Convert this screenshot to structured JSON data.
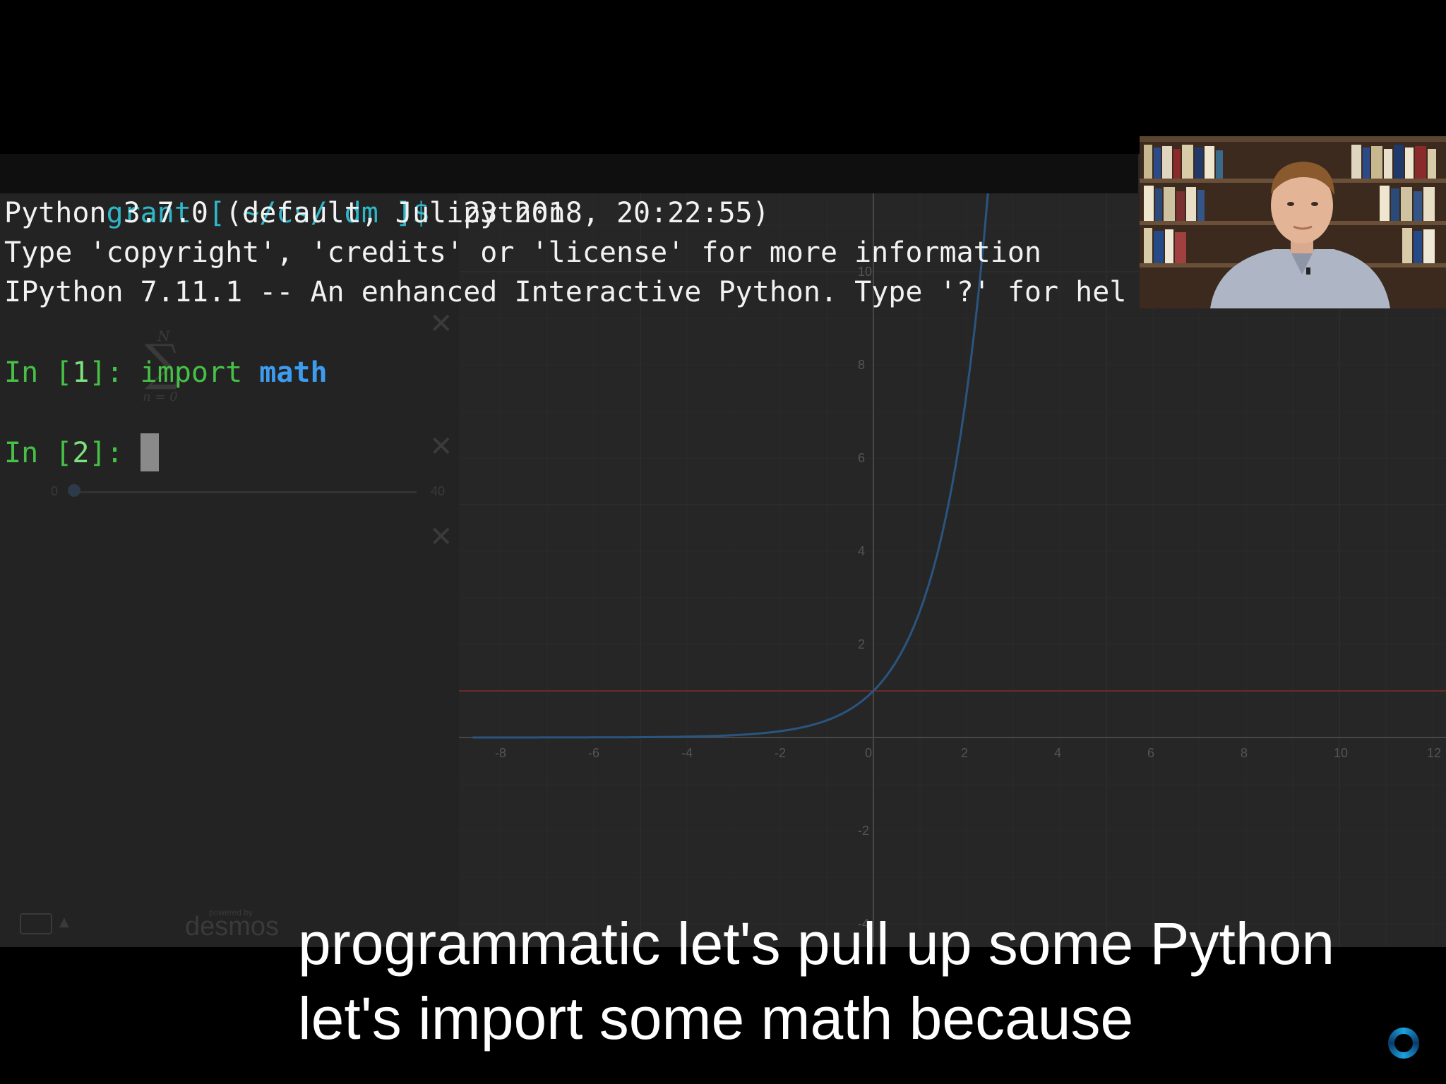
{
  "terminal": {
    "prompt_user": "grant",
    "prompt_path": "[ ~/cs/ldm ]$",
    "command": "ipython",
    "banner_1": "Python 3.7.0 (default, Jul 23 2018, 20:22:55)",
    "banner_2": "Type 'copyright', 'credits' or 'license' for more information",
    "banner_3": "IPython 7.11.1 -- An enhanced Interactive Python. Type '?' for hel",
    "cell1": {
      "in_label": "In [",
      "number": "1",
      "close": "]: ",
      "keyword": "import",
      "module": "math"
    },
    "cell2": {
      "in_label": "In [",
      "number": "2",
      "close": "]: "
    }
  },
  "graph": {
    "x_ticks": [
      "-8",
      "-6",
      "-4",
      "-2",
      "0",
      "2",
      "4",
      "6",
      "8",
      "10",
      "12"
    ],
    "y_ticks": [
      "10",
      "8",
      "6",
      "4",
      "2",
      "-2",
      "-4"
    ],
    "slider_min": "0",
    "slider_max": "40",
    "watermark": "desmos",
    "powered_by": "powered by",
    "sum_upper": "N",
    "sum_lower": "n = 0",
    "curve_color": "#2a5580",
    "hline_color": "#6a2a2a"
  },
  "captions": {
    "line1": "programmatic let's pull up some Python",
    "line2": "let's import some math because"
  },
  "colors": {
    "prompt_cyan": "#2fb7c9",
    "prompt_green": "#46c146",
    "keyword_blue": "#3d9cf0"
  }
}
